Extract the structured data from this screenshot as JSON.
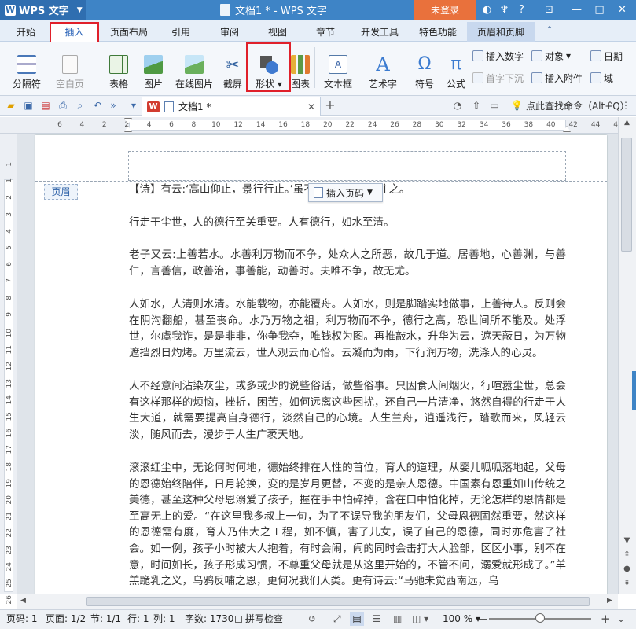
{
  "titlebar": {
    "app_menu": "WPS 文字",
    "doc_title": "文档1 * - WPS 文字",
    "login": "未登录",
    "icons": [
      "skin-icon",
      "shirt-icon",
      "help-icon",
      "window-icon",
      "minimize-icon",
      "maximize-icon",
      "close-icon"
    ]
  },
  "tabs": [
    "开始",
    "插入",
    "页面布局",
    "引用",
    "审阅",
    "视图",
    "章节",
    "开发工具",
    "特色功能",
    "页眉和页脚"
  ],
  "ribbon": {
    "sep": "分隔符",
    "blank": "空白页",
    "table": "表格",
    "picture": "图片",
    "online_pic": "在线图片",
    "screenshot": "截屏",
    "shape": "形状",
    "chart": "图表",
    "textbox": "文本框",
    "wordart": "艺术字",
    "symbol": "符号",
    "formula": "公式",
    "insert_number": "插入数字",
    "dropcap": "首字下沉",
    "object": "对象",
    "attachment": "插入附件",
    "date": "日期",
    "field": "域"
  },
  "doc_tab": {
    "logo": "W",
    "name": "文档1 *"
  },
  "cmd_search": "点此查找命令（Alt+Q）",
  "ruler": {
    "h_ticks": [
      "6",
      "4",
      "2",
      "2",
      "4",
      "6",
      "8",
      "10",
      "12",
      "14",
      "16",
      "18",
      "20",
      "22",
      "24",
      "26",
      "28",
      "30",
      "32",
      "34",
      "36",
      "38",
      "40",
      "42",
      "44",
      "46"
    ],
    "v_ticks": [
      "1",
      "1",
      "2",
      "3",
      "4",
      "5",
      "6",
      "7",
      "8",
      "9",
      "10",
      "11",
      "12",
      "13",
      "14",
      "15",
      "16",
      "17",
      "18",
      "19",
      "20",
      "21",
      "22",
      "23",
      "24",
      "25",
      "26",
      "27"
    ]
  },
  "header": {
    "tag": "页眉",
    "insert_page_no": "插入页码"
  },
  "body": {
    "p1": "【诗】有云:‘高山仰止，景行行止。’虽不能至，然心向往之。",
    "p2": "行走于尘世，人的德行至关重要。人有德行，如水至清。",
    "p3": "老子又云:上善若水。水善利万物而不争，处众人之所恶，故几于道。居善地，心善渊，与善仁，言善信，政善治，事善能，动善时。夫唯不争，故无尤。",
    "p4": "人如水，人清则水清。水能载物，亦能覆舟。人如水，则是脚踏实地做事，上善待人。反则会在阴沟翻船，甚至丧命。水乃万物之祖，利万物而不争，德行之高，恐世间所不能及。处浮世，尔虞我诈，是是非非，你争我夺，唯钱权为图。再推敲水，升华为云，遮天蔽日，为万物遮挡烈日灼烤。万里流云，世人观云而心怡。云凝而为雨，下行润万物，洗涤人的心灵。",
    "p5": "人不经意间沾染灰尘，或多或少的说些俗话，做些俗事。只因食人间烟火，行喧嚣尘世，总会有这样那样的烦恼，挫折，困苦，如何远离这些困扰，还自己一片清净，悠然自得的行走于人生大道，就需要提高自身德行，淡然自己的心境。人生兰舟，逍遥浅行，踏歌而来，风轻云淡，随风而去，漫步于人生广袤天地。",
    "p6": "滚滚红尘中，无论何时何地，德始终排在人性的首位，育人的道理，从婴儿呱呱落地起，父母的恩德始终陪伴，日月轮换，变的是岁月更替，不变的是亲人恩德。中国素有恩重如山传统之美德，甚至这种父母恩溺爱了孩子，握在手中怕碎掉，含在口中怕化掉，无论怎样的恩情都是至高无上的爱。“在这里我多叔上一句，为了不误导我的朋友们，父母恩德固然重要，然这样的恩德需有度，育人乃伟大之工程，如不慎，害了儿女，误了自己的恩德，同时亦危害了社会。如一例，孩子小时被大人抱着，有时会闹，闹的同时会击打大人脸部，区区小事，别不在意，时间如长，孩子形成习惯，不尊重父母就是从这里开始的，不管不问，溺爱就形成了。”羊羔跪乳之义，乌鸦反哺之恩，更何况我们人类。更有诗云:“马驰未觉西南远，乌"
  },
  "status": {
    "page": "页码: 1",
    "pages": "页面: 1/2",
    "section": "节: 1/1",
    "row": "行: 1",
    "col": "列: 1",
    "words": "字数: 1730",
    "spell": "拼写检查",
    "zoom": "100 %",
    "zoom_level": 0.5
  }
}
